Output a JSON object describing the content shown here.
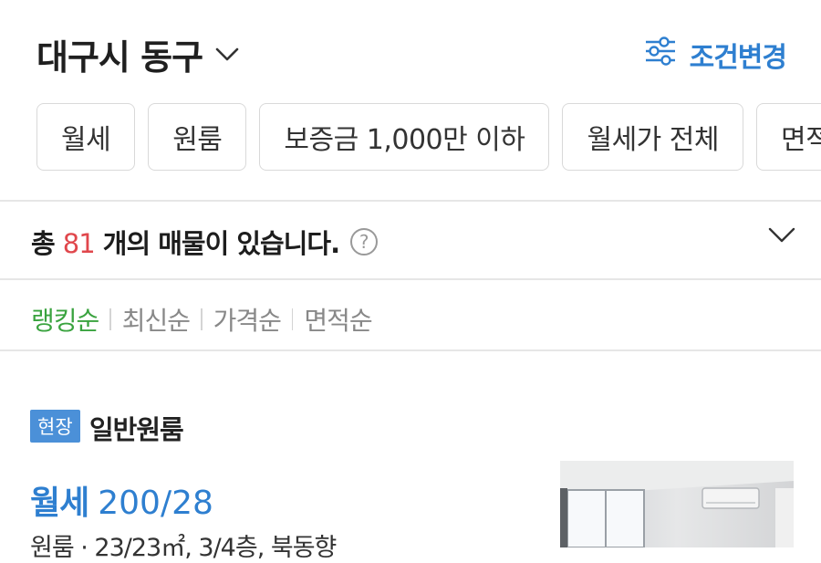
{
  "header": {
    "region": "대구시 동구",
    "region_chevron_icon": "chevron-down-icon",
    "filter_change_label": "조건변경",
    "filter_icon": "sliders-icon",
    "accent_color": "#2e7fd0"
  },
  "chips": [
    "월세",
    "원룸",
    "보증금 1,000만 이하",
    "월세가 전체",
    "면적"
  ],
  "results": {
    "prefix": "총 ",
    "count": "81",
    "suffix": " 개의 매물이 있습니다.",
    "count_color": "#e0474c",
    "help_icon": "question-circle-icon",
    "expand_icon": "chevron-down-icon"
  },
  "sort": {
    "options": [
      "랭킹순",
      "최신순",
      "가격순",
      "면적순"
    ],
    "active": "랭킹순",
    "active_color": "#3aa33f"
  },
  "listing": {
    "badge": "현장",
    "type": "일반원룸",
    "price_type": "월세",
    "price": "200/28",
    "detail": "원룸 · 23/23㎡, 3/4층, 북동향"
  }
}
